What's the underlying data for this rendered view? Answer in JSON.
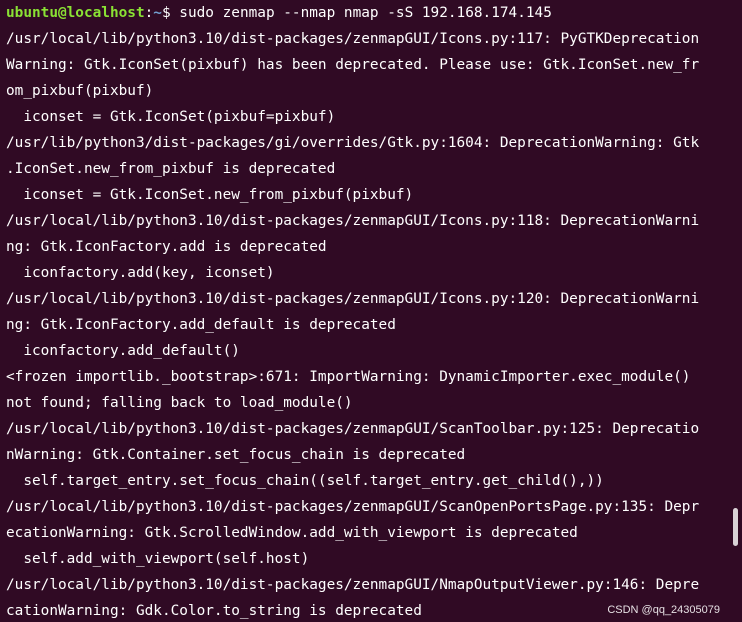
{
  "colors": {
    "background": "#300a24",
    "text": "#ffffff",
    "prompt_user": "#8ae234",
    "prompt_path": "#729fcf"
  },
  "prompt": {
    "user_host": "ubuntu@localhost",
    "separator": ":",
    "path": "~",
    "symbol": "$",
    "command": " sudo zenmap --nmap nmap -sS 192.168.174.145"
  },
  "output_lines": [
    "/usr/local/lib/python3.10/dist-packages/zenmapGUI/Icons.py:117: PyGTKDeprecation",
    "Warning: Gtk.IconSet(pixbuf) has been deprecated. Please use: Gtk.IconSet.new_fr",
    "om_pixbuf(pixbuf)",
    "  iconset = Gtk.IconSet(pixbuf=pixbuf)",
    "/usr/lib/python3/dist-packages/gi/overrides/Gtk.py:1604: DeprecationWarning: Gtk",
    ".IconSet.new_from_pixbuf is deprecated",
    "  iconset = Gtk.IconSet.new_from_pixbuf(pixbuf)",
    "/usr/local/lib/python3.10/dist-packages/zenmapGUI/Icons.py:118: DeprecationWarni",
    "ng: Gtk.IconFactory.add is deprecated",
    "  iconfactory.add(key, iconset)",
    "/usr/local/lib/python3.10/dist-packages/zenmapGUI/Icons.py:120: DeprecationWarni",
    "ng: Gtk.IconFactory.add_default is deprecated",
    "  iconfactory.add_default()",
    "<frozen importlib._bootstrap>:671: ImportWarning: DynamicImporter.exec_module()",
    "not found; falling back to load_module()",
    "/usr/local/lib/python3.10/dist-packages/zenmapGUI/ScanToolbar.py:125: Deprecatio",
    "nWarning: Gtk.Container.set_focus_chain is deprecated",
    "  self.target_entry.set_focus_chain((self.target_entry.get_child(),))",
    "/usr/local/lib/python3.10/dist-packages/zenmapGUI/ScanOpenPortsPage.py:135: Depr",
    "ecationWarning: Gtk.ScrolledWindow.add_with_viewport is deprecated",
    "  self.add_with_viewport(self.host)",
    "/usr/local/lib/python3.10/dist-packages/zenmapGUI/NmapOutputViewer.py:146: Depre",
    "cationWarning: Gdk.Color.to_string is deprecated"
  ],
  "watermark": "CSDN @qq_24305079"
}
